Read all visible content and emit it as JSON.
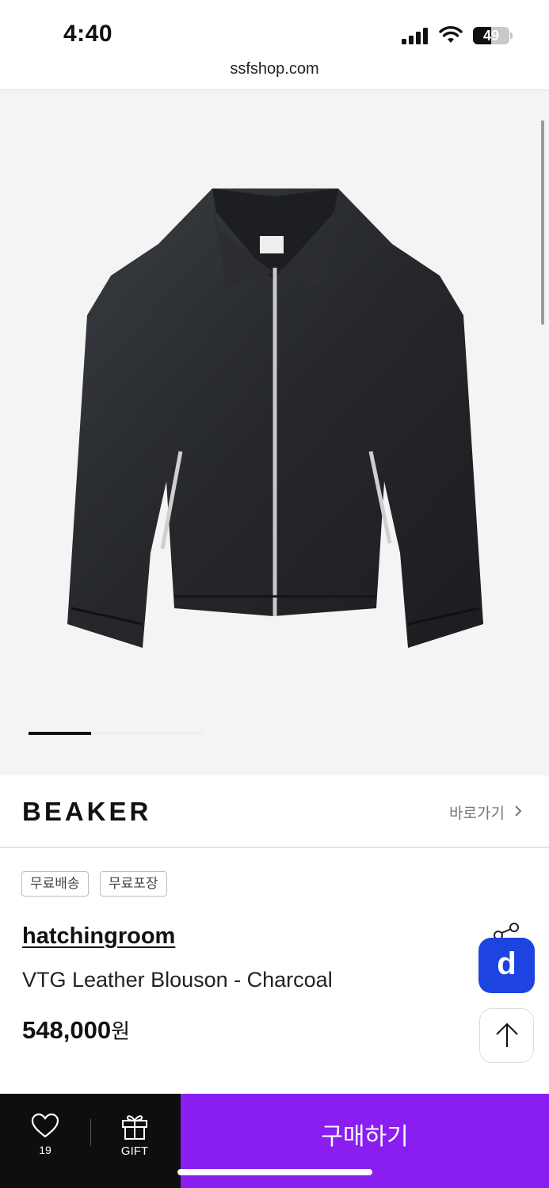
{
  "status_bar": {
    "time": "4:40",
    "battery_percent": "49",
    "battery_level": 0.49
  },
  "browser": {
    "url": "ssfshop.com"
  },
  "gallery": {
    "image_alt": "charcoal leather blouson jacket",
    "current_slide": 1,
    "total_slides": 3
  },
  "brand": {
    "logo_text": "BEAKER",
    "link_label": "바로가기"
  },
  "badges": [
    "무료배송",
    "무료포장"
  ],
  "product": {
    "shop_name": "hatchingroom",
    "name": "VTG Leather Blouson - Charcoal",
    "price": "548,000",
    "currency": "원"
  },
  "floating": {
    "d_button_label": "d"
  },
  "bottom_bar": {
    "like_count": "19",
    "gift_label": "GIFT",
    "buy_label": "구매하기"
  },
  "icons": [
    "signal-icon",
    "wifi-icon",
    "battery-icon",
    "chevron-right-icon",
    "share-icon",
    "arrow-up-icon",
    "heart-icon",
    "gift-icon"
  ],
  "colors": {
    "buy_button": "#8a1ef0",
    "d_button": "#1d44e0",
    "bottom_dark": "#0e0e0e"
  }
}
